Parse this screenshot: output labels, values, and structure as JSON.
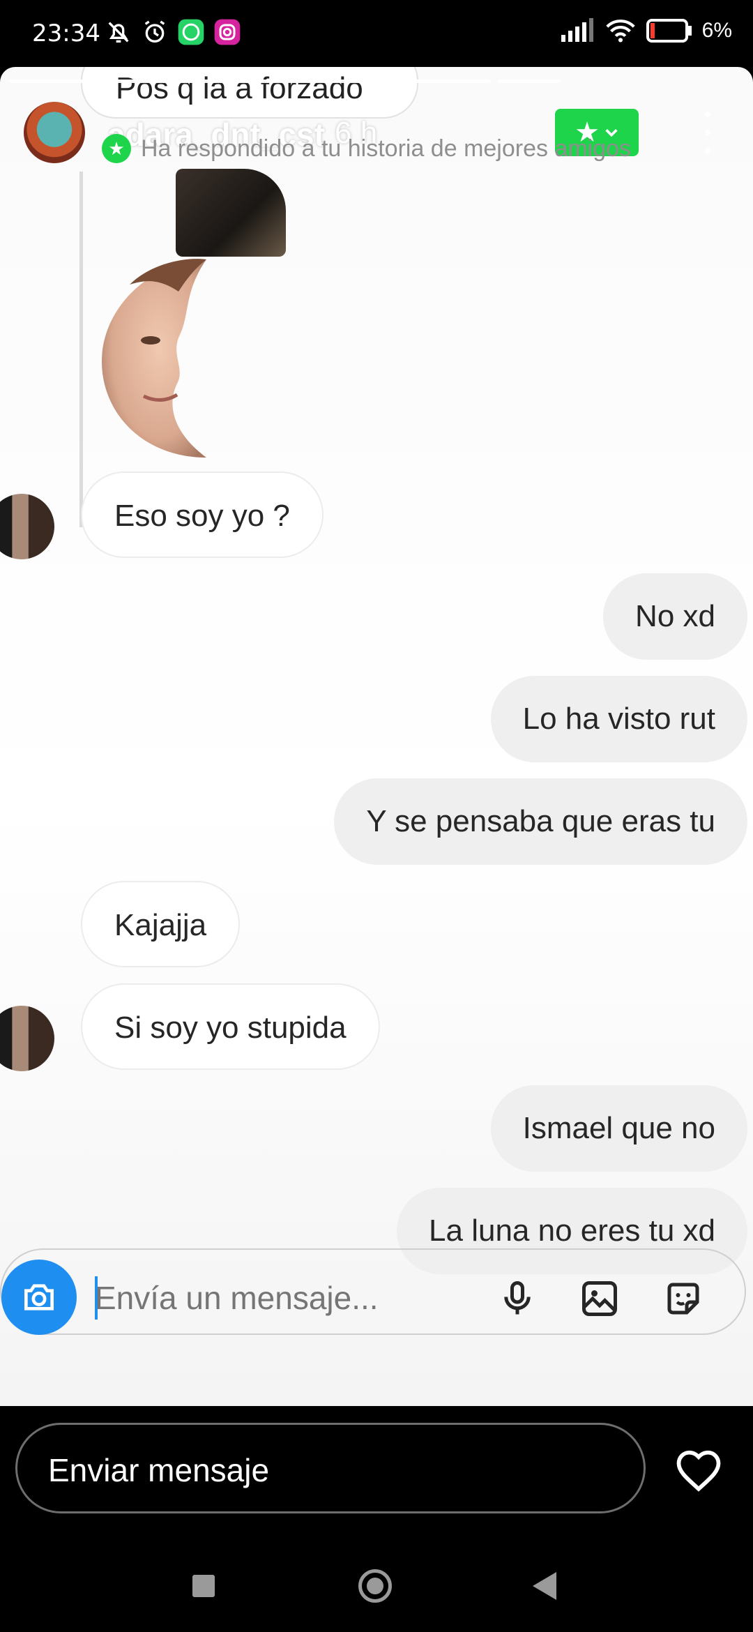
{
  "status_bar": {
    "time": "23:34",
    "battery": "6%",
    "icons": [
      "notifications-off-icon",
      "alarm-icon",
      "whatsapp-icon",
      "instagram-icon",
      "signal-icon",
      "wifi-icon",
      "battery-icon"
    ]
  },
  "story": {
    "previous_message": "Pos q la a forzado",
    "username": "adara_dnt_cst",
    "time_ago": "6 h",
    "reply_note": "Ha respondido a tu historia de mejores amigos",
    "close_friends_color": "#1ed44a"
  },
  "messages": [
    {
      "from": "them",
      "text": "Eso soy yo ?",
      "avatar": true
    },
    {
      "from": "me",
      "text": "No xd"
    },
    {
      "from": "me",
      "text": "Lo ha visto rut"
    },
    {
      "from": "me",
      "text": "Y se pensaba que eras tu"
    },
    {
      "from": "them",
      "text": "Kajajja",
      "avatar": false
    },
    {
      "from": "them",
      "text": "Si soy yo stupida",
      "avatar": true
    },
    {
      "from": "me",
      "text": "Ismael que no"
    },
    {
      "from": "me",
      "text": "La luna no eres tu xd"
    }
  ],
  "composer": {
    "placeholder": "Envía un mensaje...",
    "accent": "#1e8ef1"
  },
  "footer": {
    "send_message_label": "Enviar mensaje"
  }
}
